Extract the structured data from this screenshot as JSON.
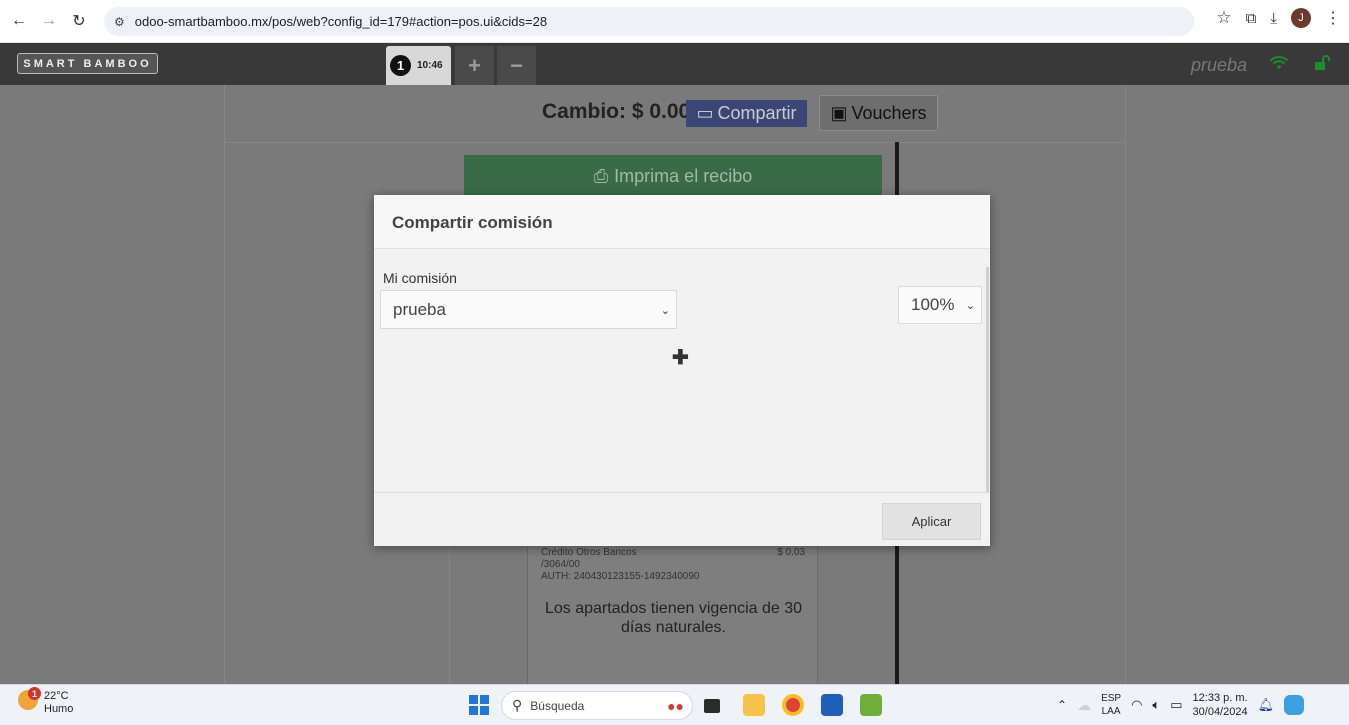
{
  "browser": {
    "url": "odoo-smartbamboo.mx/pos/web?config_id=179#action=pos.ui&cids=28",
    "profile_initial": "J"
  },
  "pos_header": {
    "logo": "SMART BAMBOO",
    "order_number": "1",
    "order_time": "10:46",
    "add_order": "+",
    "remove_order": "−",
    "cashier": "prueba"
  },
  "payment": {
    "change_label": "Cambio: $ 0.00",
    "share_button": "Compartir",
    "vouchers_button": "Vouchers",
    "print_button": "Imprima el recibo"
  },
  "receipt": {
    "method": "Crédito Otros Bancos",
    "amount": "$ 0.03",
    "ref": "/3064/00",
    "auth": "AUTH: 240430123155-1492340090",
    "note": "Los apartados tienen vigencia de 30 días naturales."
  },
  "modal": {
    "title": "Compartir comisión",
    "label": "Mi comisión",
    "user_value": "prueba",
    "percent_value": "100%",
    "add_label": "✚",
    "apply_button": "Aplicar"
  },
  "taskbar": {
    "temperature": "22°C",
    "weather": "Humo",
    "weather_badge": "1",
    "search_placeholder": "Búsqueda",
    "lang_top": "ESP",
    "lang_bottom": "LAA",
    "time": "12:33 p. m.",
    "date": "30/04/2024"
  },
  "colors": {
    "pos_header": "#393939",
    "overlay_bg": "#7a7a7a",
    "share_button": "#3c4674",
    "print_button": "#3a6b47",
    "modal_bg": "#f2f2f2"
  }
}
